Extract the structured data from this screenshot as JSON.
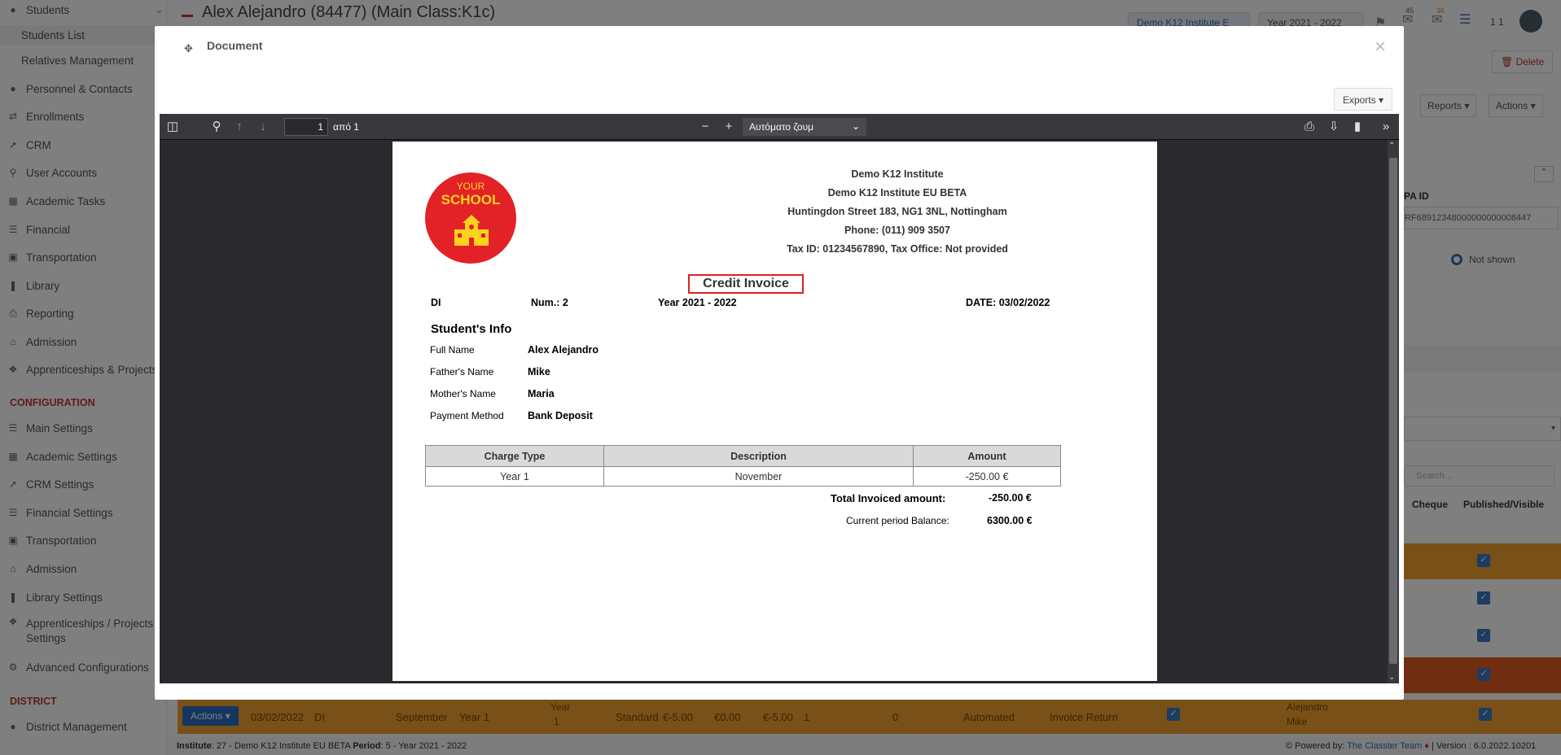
{
  "sidebar": {
    "header": "Students",
    "items": [
      {
        "label": "Students List",
        "icon": "list-icon"
      },
      {
        "label": "Relatives Management",
        "icon": "users-icon"
      },
      {
        "label": "Personnel & Contacts",
        "icon": "person-icon"
      },
      {
        "label": "Enrollments",
        "icon": "swap-icon"
      },
      {
        "label": "CRM",
        "icon": "crm-icon"
      },
      {
        "label": "User Accounts",
        "icon": "key-icon"
      },
      {
        "label": "Academic Tasks",
        "icon": "grid-icon"
      },
      {
        "label": "Financial",
        "icon": "coins-icon"
      },
      {
        "label": "Transportation",
        "icon": "bus-icon"
      },
      {
        "label": "Library",
        "icon": "books-icon"
      },
      {
        "label": "Reporting",
        "icon": "printer-icon"
      },
      {
        "label": "Admission",
        "icon": "bank-icon"
      },
      {
        "label": "Apprenticeships & Projects",
        "icon": "cube-icon"
      }
    ],
    "config_heading": "CONFIGURATION",
    "config_items": [
      {
        "label": "Main Settings",
        "icon": "sliders-icon"
      },
      {
        "label": "Academic Settings",
        "icon": "grid-icon"
      },
      {
        "label": "CRM Settings",
        "icon": "crm-icon"
      },
      {
        "label": "Financial Settings",
        "icon": "coins-icon"
      },
      {
        "label": "Transportation",
        "icon": "bus-icon"
      },
      {
        "label": "Admission",
        "icon": "bank-icon"
      },
      {
        "label": "Library Settings",
        "icon": "books-icon"
      },
      {
        "label": "Apprenticeships / Projects Settings",
        "icon": "cube-icon"
      },
      {
        "label": "Advanced Configurations",
        "icon": "gear-icon"
      }
    ],
    "district_heading": "DISTRICT",
    "district_items": [
      {
        "label": "District Management",
        "icon": "person-icon"
      }
    ]
  },
  "topbar": {
    "title": "Alex Alejandro (84477) (Main Class:K1c)",
    "institute_pill": "Demo K12 Institute E",
    "year_pill": "Year 2021 - 2022",
    "badge_1": "45",
    "badge_2": "36",
    "user_count": "1 1"
  },
  "right_panel": {
    "delete_label": "Delete",
    "reports_label": "Reports",
    "actions_label": "Actions",
    "pa_id_label": "PA ID",
    "pa_id_value": "RF68912348000000000008447",
    "not_shown_label": "Not shown",
    "search_placeholder": "Search...",
    "col_cheque": "Cheque",
    "col_published": "Published/Visible"
  },
  "modal": {
    "title": "Document",
    "exports_label": "Exports",
    "viewer": {
      "page_number": "1",
      "page_of": "από 1",
      "zoom_label": "Αυτόματο ζουμ"
    }
  },
  "invoice": {
    "logo_text_1": "YOUR",
    "logo_text_2": "SCHOOL",
    "institute_lines": [
      "Demo K12 Institute",
      "Demo K12 Institute EU BETA",
      "Huntingdon Street 183, NG1 3NL, Nottingham",
      "Phone: (011) 909 3507",
      "Tax ID: 01234567890, Tax Office: Not provided"
    ],
    "doc_title": "Credit Invoice",
    "series": "DI",
    "number": "Num.: 2",
    "year": "Year 2021 - 2022",
    "date": "DATE: 03/02/2022",
    "student_info_heading": "Student's Info",
    "fields": [
      {
        "label": "Full Name",
        "value": "Alex Alejandro"
      },
      {
        "label": "Father's Name",
        "value": "Mike"
      },
      {
        "label": "Mother's Name",
        "value": "Maria"
      },
      {
        "label": "Payment Method",
        "value": "Bank Deposit"
      }
    ],
    "table_headers": [
      "Charge Type",
      "Description",
      "Amount"
    ],
    "table_rows": [
      [
        "Year 1",
        "November",
        "-250.00 €"
      ]
    ],
    "total_label": "Total Invoiced amount:",
    "total_value": "-250.00 €",
    "balance_label": "Current period Balance:",
    "balance_value": "6300.00 €"
  },
  "bg_row": {
    "actions": "Actions",
    "date": "03/02/2022",
    "series": "DI",
    "month": "September",
    "year": "Year 1",
    "class_a": "Year",
    "class_b": "1",
    "type": "Standard",
    "amount": "€-5.00",
    "paid": "€0.00",
    "balance": "€-5.00",
    "n1": "1",
    "n2": "0",
    "mode": "Automated",
    "kind": "Invoice Return",
    "person_a": "Alejandro",
    "person_b": "Mike"
  },
  "footer": {
    "institute_label": "Institute",
    "institute_value": ": 27 - Demo K12 Institute EU BETA",
    "period_label": "Period",
    "period_value": ": 5 - Year 2021 - 2022",
    "powered": "Powered by:",
    "team": "The Classter Team",
    "version": "| Version : 6.0.2022.10201"
  }
}
